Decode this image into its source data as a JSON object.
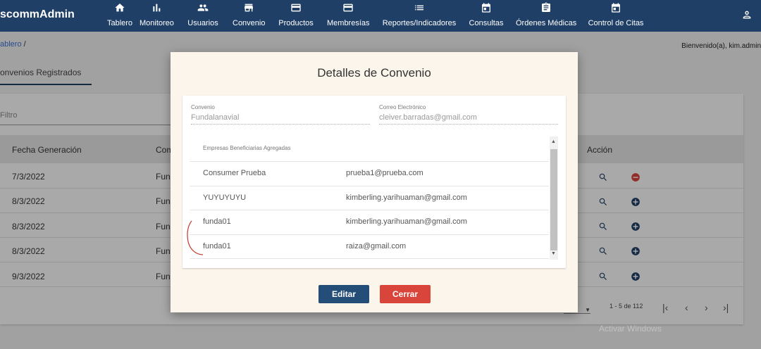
{
  "app": {
    "brand": "scommAdmin"
  },
  "nav": [
    {
      "label": "Tablero",
      "icon": "home-icon"
    },
    {
      "label": "Monitoreo",
      "icon": "bar-chart-icon"
    },
    {
      "label": "Usuarios",
      "icon": "people-icon"
    },
    {
      "label": "Convenio",
      "icon": "store-icon"
    },
    {
      "label": "Productos",
      "icon": "card-icon"
    },
    {
      "label": "Membresías",
      "icon": "card-icon"
    },
    {
      "label": "Reportes/Indicadores",
      "icon": "list-icon"
    },
    {
      "label": "Consultas",
      "icon": "calendar-icon"
    },
    {
      "label": "Órdenes Médicas",
      "icon": "clipboard-icon"
    },
    {
      "label": "Control de Citas",
      "icon": "calendar-icon"
    }
  ],
  "breadcrumb": {
    "link": "ablero",
    "sep": "/"
  },
  "welcome": "Bienvenido(a), kim.admin",
  "tab": "onvenios Registrados",
  "filter": {
    "placeholder": "Filtro"
  },
  "table": {
    "headers": [
      "Fecha Generación",
      "Com",
      "Acción"
    ],
    "rows": [
      {
        "date": "7/3/2022",
        "col2": "Func",
        "action": "remove"
      },
      {
        "date": "8/3/2022",
        "col2": "Func",
        "action": "add"
      },
      {
        "date": "8/3/2022",
        "col2": "Func",
        "action": "add"
      },
      {
        "date": "8/3/2022",
        "col2": "Func",
        "action": "add"
      },
      {
        "date": "9/3/2022",
        "col2": "Func",
        "action": "add"
      }
    ]
  },
  "pager": {
    "range": "1 - 5 de 112"
  },
  "modal": {
    "title": "Detalles de Convenio",
    "convenio_label": "Convenio",
    "convenio_value": "Fundalanavial",
    "email_label": "Correo Electrónico",
    "email_value": "cleiver.barradas@gmail.com",
    "list_header": "Empresas Beneficiarias Agregadas",
    "companies": [
      {
        "name": "Consumer Prueba",
        "email": "prueba1@prueba.com"
      },
      {
        "name": "YUYUYUYU",
        "email": "kimberling.yarihuaman@gmail.com"
      },
      {
        "name": "funda01",
        "email": "kimberling.yarihuaman@gmail.com"
      },
      {
        "name": "funda01",
        "email": "raiza@gmail.com"
      }
    ],
    "edit_label": "Editar",
    "close_label": "Cerrar"
  },
  "colors": {
    "navbar": "#1f3f66",
    "edit": "#244d77",
    "close": "#d9453a",
    "remove": "#d9453a",
    "add": "#1f3f66"
  },
  "watermark": "Activar Windows"
}
